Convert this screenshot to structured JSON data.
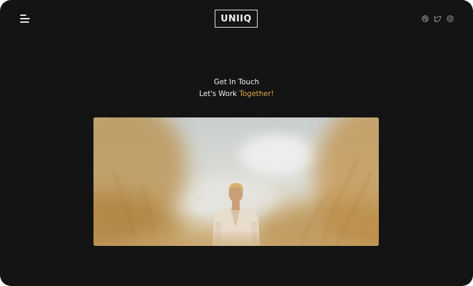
{
  "header": {
    "logo_text": "UNIIQ",
    "menu_icon": "hamburger-menu-icon",
    "social_icons": [
      "dribbble-icon",
      "twitter-icon",
      "instagram-icon"
    ]
  },
  "contact": {
    "title": "Get In Touch",
    "subtitle_prefix": "Let's Work ",
    "subtitle_accent": "Together!"
  },
  "hero": {
    "image_subject": "person-in-wheat-field-photo"
  },
  "colors": {
    "background": "#131313",
    "text": "#f1f1f1",
    "accent": "#e0a948"
  }
}
